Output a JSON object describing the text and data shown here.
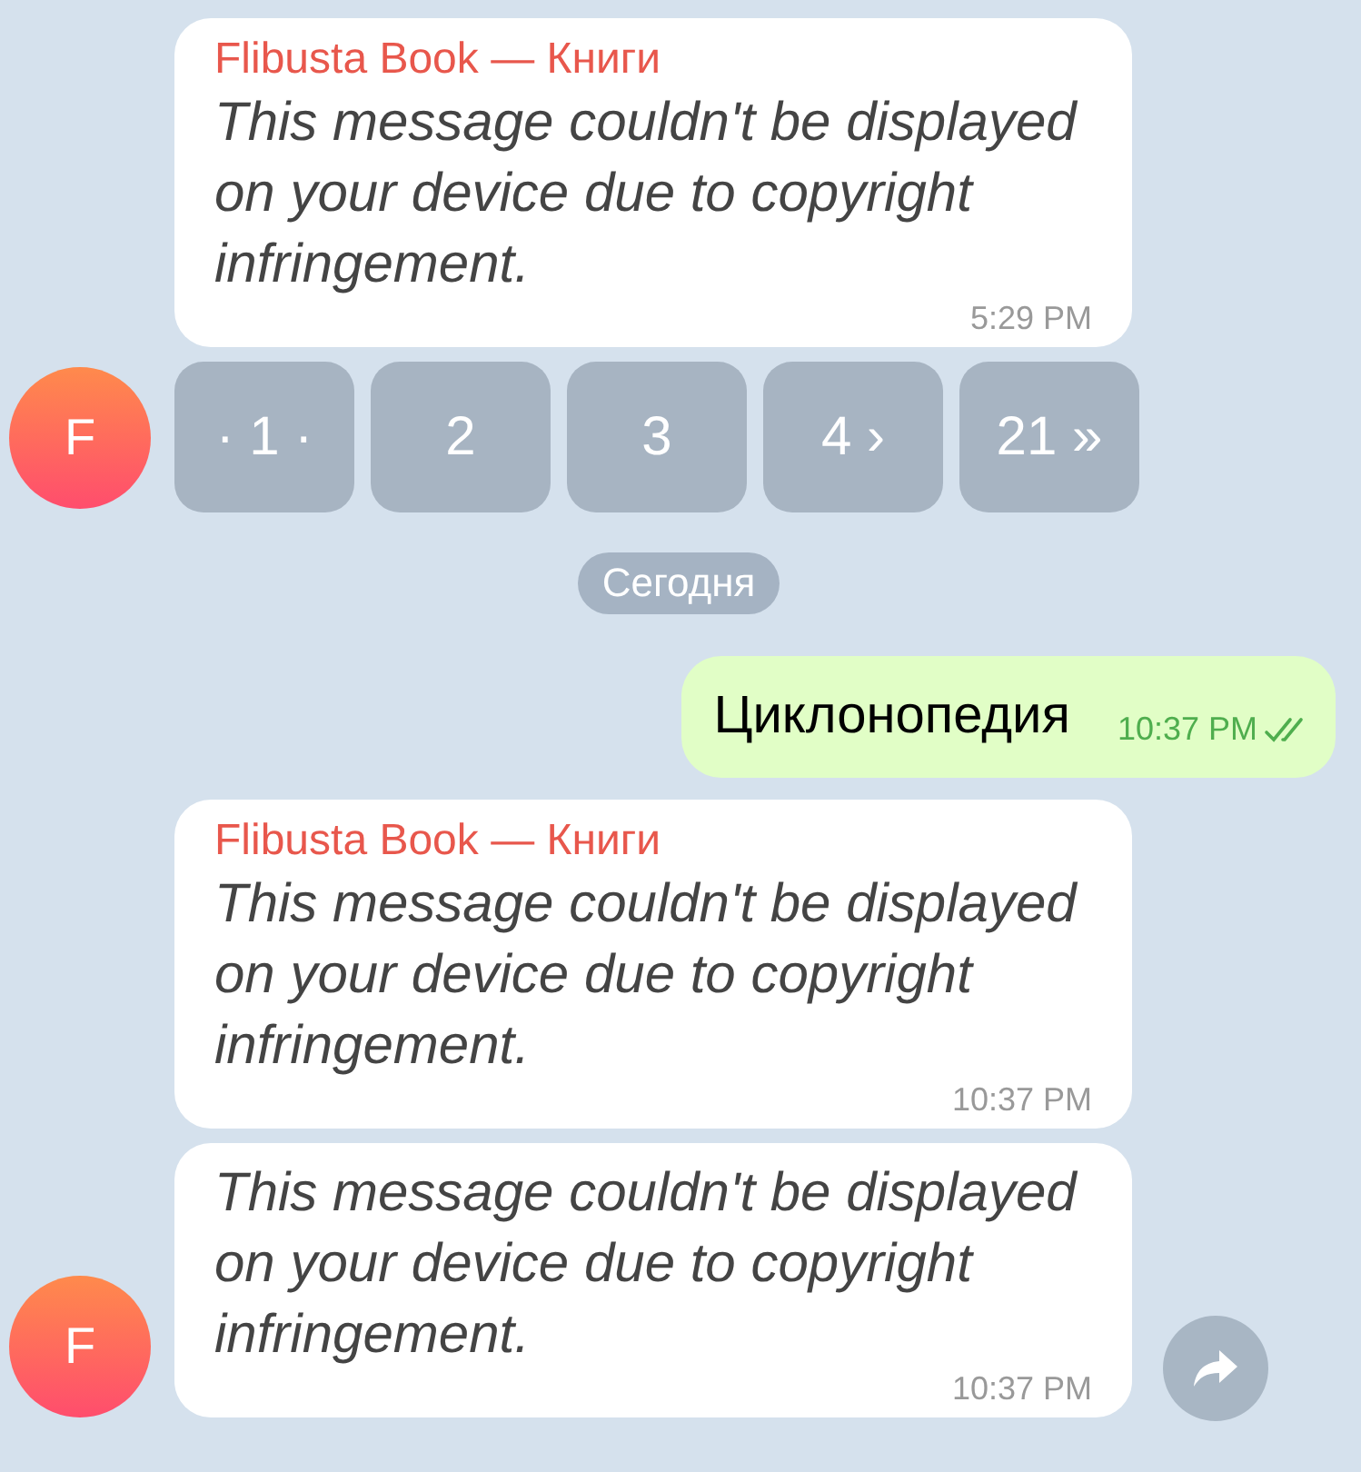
{
  "messages": [
    {
      "kind": "incoming",
      "sender": "Flibusta Book — Книги",
      "text": "This message couldn't be displayed on your device due to copyright infringement.",
      "time": "5:29 PM"
    },
    {
      "kind": "buttons",
      "avatar": "F",
      "buttons": [
        "· 1 ·",
        "2",
        "3",
        "4 ›",
        "21 »"
      ]
    },
    {
      "kind": "date",
      "text": "Сегодня"
    },
    {
      "kind": "outgoing",
      "text": "Циклонопедия",
      "time": "10:37 PM",
      "read": true
    },
    {
      "kind": "incoming",
      "sender": "Flibusta Book — Книги",
      "text": "This message couldn't be displayed on your device due to copyright infringement.",
      "time": "10:37 PM"
    },
    {
      "kind": "incoming",
      "avatar": "F",
      "text": "This message couldn't be displayed on your device due to copyright infringement.",
      "time": "10:37 PM",
      "share": true
    }
  ]
}
